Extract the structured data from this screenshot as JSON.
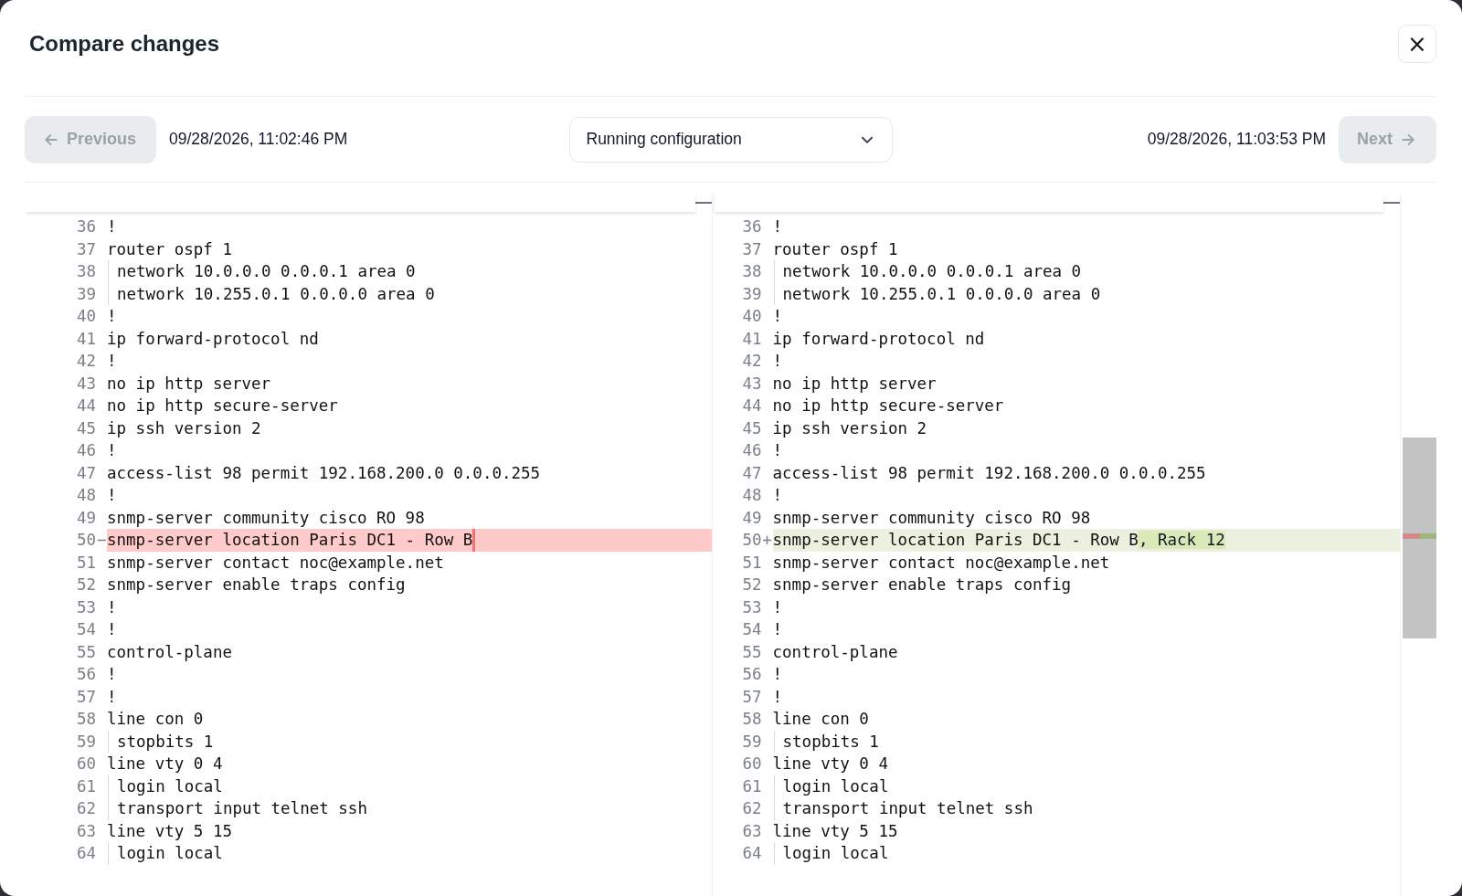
{
  "dialog": {
    "title": "Compare changes",
    "close_label": "×"
  },
  "toolbar": {
    "previous": {
      "label": "Previous",
      "disabled": true
    },
    "left_time": "09/28/2026, 11:02:46 PM",
    "select": {
      "value": "Running configuration"
    },
    "right_time": "09/28/2026, 11:03:53 PM",
    "next": {
      "label": "Next",
      "disabled": true
    }
  },
  "panes": [
    {
      "lines": [
        {
          "number": "36",
          "kind": "context",
          "indent": false,
          "text": "!"
        },
        {
          "number": "37",
          "kind": "context",
          "indent": false,
          "text": "router ospf 1"
        },
        {
          "number": "38",
          "kind": "context",
          "indent": true,
          "text": "network 10.0.0.0 0.0.0.1 area 0"
        },
        {
          "number": "39",
          "kind": "context",
          "indent": true,
          "text": "network 10.255.0.1 0.0.0.0 area 0"
        },
        {
          "number": "40",
          "kind": "context",
          "indent": false,
          "text": "!"
        },
        {
          "number": "41",
          "kind": "context",
          "indent": false,
          "text": "ip forward-protocol nd"
        },
        {
          "number": "42",
          "kind": "context",
          "indent": false,
          "text": "!"
        },
        {
          "number": "43",
          "kind": "context",
          "indent": false,
          "text": "no ip http server"
        },
        {
          "number": "44",
          "kind": "context",
          "indent": false,
          "text": "no ip http secure-server"
        },
        {
          "number": "45",
          "kind": "context",
          "indent": false,
          "text": "ip ssh version 2"
        },
        {
          "number": "46",
          "kind": "context",
          "indent": false,
          "text": "!"
        },
        {
          "number": "47",
          "kind": "context",
          "indent": false,
          "text": "access-list 98 permit 192.168.200.0 0.0.0.255"
        },
        {
          "number": "48",
          "kind": "context",
          "indent": false,
          "text": "!"
        },
        {
          "number": "49",
          "kind": "context",
          "indent": false,
          "text": "snmp-server community cisco RO 98"
        },
        {
          "number": "50",
          "kind": "removed",
          "sign": "−",
          "indent": false,
          "text": "snmp-server location Paris DC1 - Row B"
        },
        {
          "number": "51",
          "kind": "context",
          "indent": false,
          "text": "snmp-server contact noc@example.net"
        },
        {
          "number": "52",
          "kind": "context",
          "indent": false,
          "text": "snmp-server enable traps config"
        },
        {
          "number": "53",
          "kind": "context",
          "indent": false,
          "text": "!"
        },
        {
          "number": "54",
          "kind": "context",
          "indent": false,
          "text": "!"
        },
        {
          "number": "55",
          "kind": "context",
          "indent": false,
          "text": "control-plane"
        },
        {
          "number": "56",
          "kind": "context",
          "indent": false,
          "text": "!"
        },
        {
          "number": "57",
          "kind": "context",
          "indent": false,
          "text": "!"
        },
        {
          "number": "58",
          "kind": "context",
          "indent": false,
          "text": "line con 0"
        },
        {
          "number": "59",
          "kind": "context",
          "indent": true,
          "text": "stopbits 1"
        },
        {
          "number": "60",
          "kind": "context",
          "indent": false,
          "text": "line vty 0 4"
        },
        {
          "number": "61",
          "kind": "context",
          "indent": true,
          "text": "login local"
        },
        {
          "number": "62",
          "kind": "context",
          "indent": true,
          "text": "transport input telnet ssh"
        },
        {
          "number": "63",
          "kind": "context",
          "indent": false,
          "text": "line vty 5 15"
        },
        {
          "number": "64",
          "kind": "context",
          "indent": true,
          "text": "login local"
        }
      ]
    },
    {
      "lines": [
        {
          "number": "36",
          "kind": "context",
          "indent": false,
          "text": "!"
        },
        {
          "number": "37",
          "kind": "context",
          "indent": false,
          "text": "router ospf 1"
        },
        {
          "number": "38",
          "kind": "context",
          "indent": true,
          "text": "network 10.0.0.0 0.0.0.1 area 0"
        },
        {
          "number": "39",
          "kind": "context",
          "indent": true,
          "text": "network 10.255.0.1 0.0.0.0 area 0"
        },
        {
          "number": "40",
          "kind": "context",
          "indent": false,
          "text": "!"
        },
        {
          "number": "41",
          "kind": "context",
          "indent": false,
          "text": "ip forward-protocol nd"
        },
        {
          "number": "42",
          "kind": "context",
          "indent": false,
          "text": "!"
        },
        {
          "number": "43",
          "kind": "context",
          "indent": false,
          "text": "no ip http server"
        },
        {
          "number": "44",
          "kind": "context",
          "indent": false,
          "text": "no ip http secure-server"
        },
        {
          "number": "45",
          "kind": "context",
          "indent": false,
          "text": "ip ssh version 2"
        },
        {
          "number": "46",
          "kind": "context",
          "indent": false,
          "text": "!"
        },
        {
          "number": "47",
          "kind": "context",
          "indent": false,
          "text": "access-list 98 permit 192.168.200.0 0.0.0.255"
        },
        {
          "number": "48",
          "kind": "context",
          "indent": false,
          "text": "!"
        },
        {
          "number": "49",
          "kind": "context",
          "indent": false,
          "text": "snmp-server community cisco RO 98"
        },
        {
          "number": "50",
          "kind": "added",
          "sign": "+",
          "indent": false,
          "text": "snmp-server location Paris DC1 - Row B",
          "change": ", Rack 12"
        },
        {
          "number": "51",
          "kind": "context",
          "indent": false,
          "text": "snmp-server contact noc@example.net"
        },
        {
          "number": "52",
          "kind": "context",
          "indent": false,
          "text": "snmp-server enable traps config"
        },
        {
          "number": "53",
          "kind": "context",
          "indent": false,
          "text": "!"
        },
        {
          "number": "54",
          "kind": "context",
          "indent": false,
          "text": "!"
        },
        {
          "number": "55",
          "kind": "context",
          "indent": false,
          "text": "control-plane"
        },
        {
          "number": "56",
          "kind": "context",
          "indent": false,
          "text": "!"
        },
        {
          "number": "57",
          "kind": "context",
          "indent": false,
          "text": "!"
        },
        {
          "number": "58",
          "kind": "context",
          "indent": false,
          "text": "line con 0"
        },
        {
          "number": "59",
          "kind": "context",
          "indent": true,
          "text": "stopbits 1"
        },
        {
          "number": "60",
          "kind": "context",
          "indent": false,
          "text": "line vty 0 4"
        },
        {
          "number": "61",
          "kind": "context",
          "indent": true,
          "text": "login local"
        },
        {
          "number": "62",
          "kind": "context",
          "indent": true,
          "text": "transport input telnet ssh"
        },
        {
          "number": "63",
          "kind": "context",
          "indent": false,
          "text": "line vty 5 15"
        },
        {
          "number": "64",
          "kind": "context",
          "indent": true,
          "text": "login local"
        }
      ]
    }
  ]
}
